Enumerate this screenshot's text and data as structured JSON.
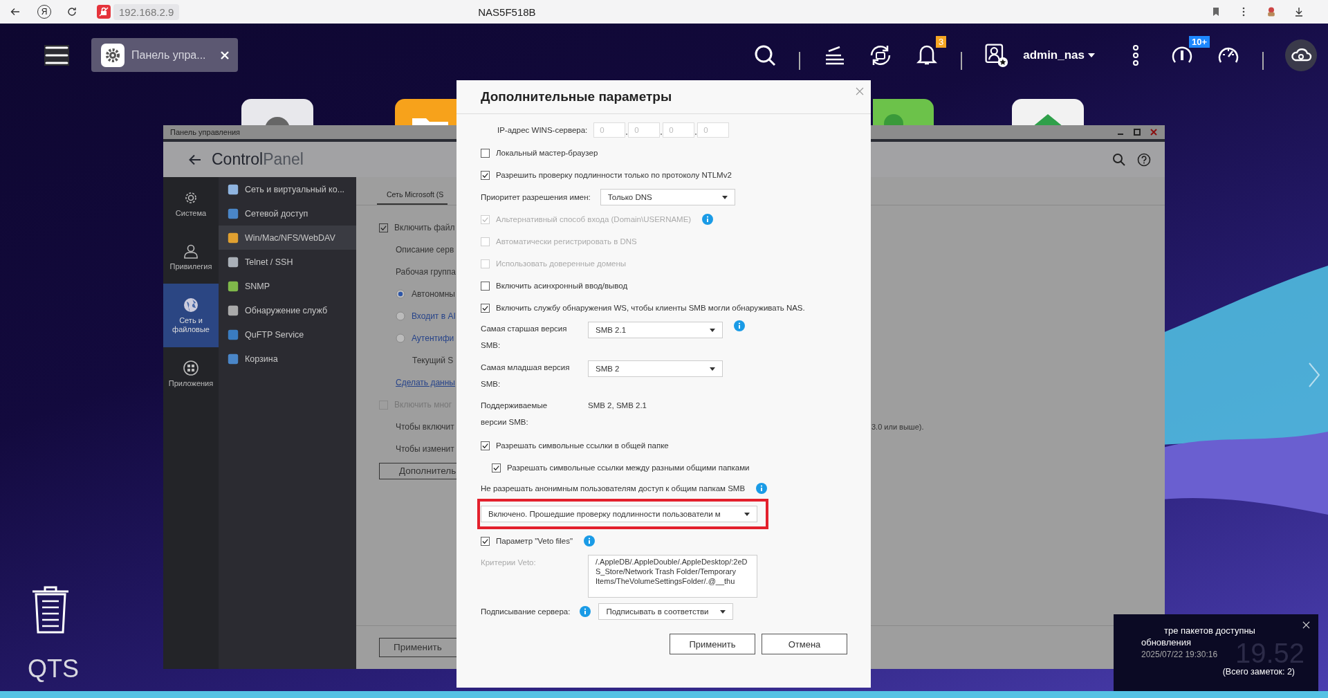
{
  "browser": {
    "logo": "Я",
    "url": "192.168.2.9",
    "title": "NAS5F518B"
  },
  "topbar": {
    "tabs": [
      {
        "label": "Панель упра...",
        "selected": true
      }
    ],
    "notifications": "3",
    "user": "admin_nas",
    "updates": "10+"
  },
  "control_panel": {
    "title": "Панель управления",
    "heading_bold": "Control",
    "heading_light": "Panel",
    "rail": [
      {
        "label": "Система",
        "selected": false
      },
      {
        "label": "Привилегия",
        "selected": false
      },
      {
        "label": "Сеть и файловые",
        "selected": true
      },
      {
        "label": "Приложения",
        "selected": false
      }
    ],
    "menu": [
      {
        "label": "Сеть и виртуальный ко...",
        "selected": false
      },
      {
        "label": "Сетевой доступ",
        "selected": false
      },
      {
        "label": "Win/Mac/NFS/WebDAV",
        "selected": true
      },
      {
        "label": "Telnet / SSH",
        "selected": false
      },
      {
        "label": "SNMP",
        "selected": false
      },
      {
        "label": "Обнаружение служб",
        "selected": false
      },
      {
        "label": "QuFTP Service",
        "selected": false
      },
      {
        "label": "Корзина",
        "selected": false
      }
    ],
    "tabs": [
      {
        "label": "Сеть Microsoft (S",
        "selected": true
      }
    ],
    "content": [
      {
        "kind": "checkbox",
        "label": "Включить файл",
        "checked": true,
        "disabled": false,
        "children": [
          {
            "kind": "text",
            "label": "Описание серв"
          },
          {
            "kind": "text",
            "label": "Рабочая группа"
          },
          {
            "kind": "radio",
            "label": "Автономны",
            "selected": true
          },
          {
            "kind": "radio",
            "label": "Входит в AI",
            "selected": false
          },
          {
            "kind": "radio",
            "label": "Аутентифи",
            "selected": false,
            "children": [
              {
                "kind": "text",
                "label": "Текущий S"
              }
            ]
          },
          {
            "kind": "link",
            "label": "Сделать данны"
          }
        ]
      },
      {
        "kind": "checkbox",
        "label": "Включить мног",
        "checked": false,
        "disabled": true,
        "children": [
          {
            "kind": "text",
            "label": "Чтобы включит",
            "tail": "3.0 или выше)."
          },
          {
            "kind": "text",
            "label": "Чтобы изменит"
          }
        ]
      },
      {
        "kind": "button",
        "label": "Дополнитель"
      }
    ],
    "apply": "Применить"
  },
  "dialog": {
    "title": "Дополнительные параметры",
    "rows": [
      {
        "kind": "ip",
        "label": "IP-адрес WINS-сервера:",
        "parts": [
          "0",
          "0",
          "0",
          "0"
        ]
      },
      {
        "kind": "checkbox",
        "label": "Локальный мастер-браузер",
        "checked": false,
        "disabled": false
      },
      {
        "kind": "checkbox",
        "label": "Разрешить проверку подлинности только по протоколу NTLMv2",
        "checked": true,
        "disabled": false
      },
      {
        "kind": "select",
        "label": "Приоритет разрешения имен:",
        "value": "Только DNS"
      },
      {
        "kind": "checkbox",
        "label": "Альтернативный способ входа (Domain\\USERNAME)",
        "checked": true,
        "disabled": true,
        "info": true
      },
      {
        "kind": "checkbox",
        "label": "Автоматически регистрировать в DNS",
        "checked": false,
        "disabled": true
      },
      {
        "kind": "checkbox",
        "label": "Использовать доверенные домены",
        "checked": false,
        "disabled": true
      },
      {
        "kind": "checkbox",
        "label": "Включить асинхронный ввод/вывод",
        "checked": false,
        "disabled": false
      },
      {
        "kind": "checkbox",
        "label": "Включить службу обнаружения WS, чтобы клиенты SMB могли обнаруживать NAS.",
        "checked": true,
        "disabled": false
      },
      {
        "kind": "stacked-select",
        "label": "Самая старшая версия SMB:",
        "value": "SMB 2.1",
        "info": true
      },
      {
        "kind": "stacked-select",
        "label": "Самая младшая версия SMB:",
        "value": "SMB 2"
      },
      {
        "kind": "text",
        "label": "Поддерживаемые версии SMB:",
        "value": "SMB 2, SMB 2.1"
      },
      {
        "kind": "checkbox",
        "label": "Разрешать символьные ссылки в общей папке",
        "checked": true,
        "disabled": false,
        "children": [
          {
            "kind": "checkbox",
            "label": "Разрешать символьные ссылки между разными общими папками",
            "checked": true,
            "disabled": false
          }
        ]
      },
      {
        "kind": "heading",
        "label": "Не разрешать анонимным пользователям доступ к общим папкам SMB",
        "info": true
      },
      {
        "kind": "wide-select",
        "value": "Включено. Прошедшие проверку подлинности пользователи м",
        "highlighted": true
      },
      {
        "kind": "checkbox",
        "label": "Параметр \"Veto files\"",
        "checked": true,
        "disabled": false,
        "info": true
      },
      {
        "kind": "textarea",
        "label": "Критерии Veto:",
        "value": "/.AppleDB/.AppleDouble/.AppleDesktop/:2eDS_Store/Network Trash Folder/Temporary Items/TheVolumeSettingsFolder/.@__thu"
      },
      {
        "kind": "select",
        "label": "Подписывание сервера:",
        "value": "Подписывать в соответстви",
        "info": true
      }
    ],
    "buttons": [
      "Применить",
      "Отмена"
    ]
  },
  "notification": {
    "lines": [
      "тре пакетов доступны",
      "обновления"
    ],
    "time": "2025/07/22 19:30:16",
    "total": "(Всего заметок: 2)"
  },
  "clock": "19.52",
  "desktop": {
    "label": "QTS"
  }
}
